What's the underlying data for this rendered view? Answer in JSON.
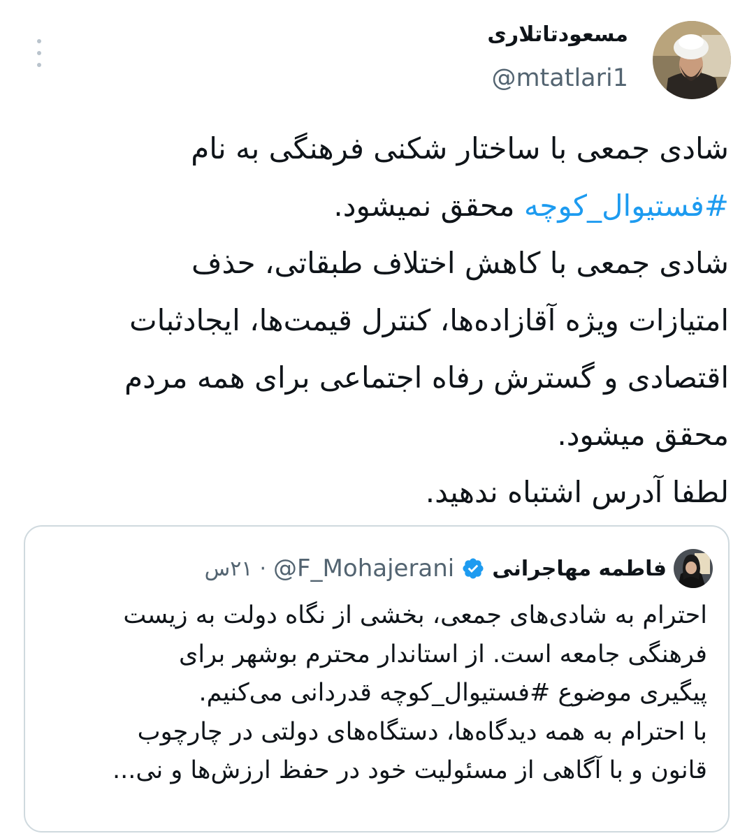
{
  "author": {
    "name": "مسعودتاتلاری",
    "handle": "@mtatlari1"
  },
  "tweet": {
    "lines": [
      "شادی جمعی با ساختار شکنی فرهنگی به نام",
      "محقق نمیشود.",
      "شادی جمعی با کاهش اختلاف طبقاتی، حذف",
      "امتیازات ویژه آقازاده‌ها، کنترل قیمت‌ها، ایجادثبات",
      "اقتصادی و گسترش رفاه اجتماعی برای همه مردم",
      "محقق میشود.",
      "لطفا آدرس اشتباه ندهید."
    ],
    "hashtag": "#فستیوال_کوچه"
  },
  "quote": {
    "name": "فاطمه مهاجرانی",
    "handle": "@F_Mohajerani",
    "separator": "·",
    "time": "۲۱س",
    "lines": [
      "احترام به شادی‌های جمعی، بخشی از نگاه دولت به زیست",
      "فرهنگی جامعه است. از استاندار محترم بوشهر برای",
      "پیگیری موضوع #فستیوال_کوچه قدردانی می‌کنیم.",
      "با احترام به همه دیدگاه‌ها، دستگاه‌های دولتی در چارچوب",
      "قانون و با آگاهی از مسئولیت خود در حفظ ارزش‌ها و نی..."
    ]
  },
  "icons": {
    "more": "more-vertical-icon",
    "verified": "verified-badge-icon"
  },
  "colors": {
    "link": "#1d9bf0",
    "verified": "#1d9bf0",
    "secondary_text": "#536471",
    "card_border": "#cfd9de"
  }
}
